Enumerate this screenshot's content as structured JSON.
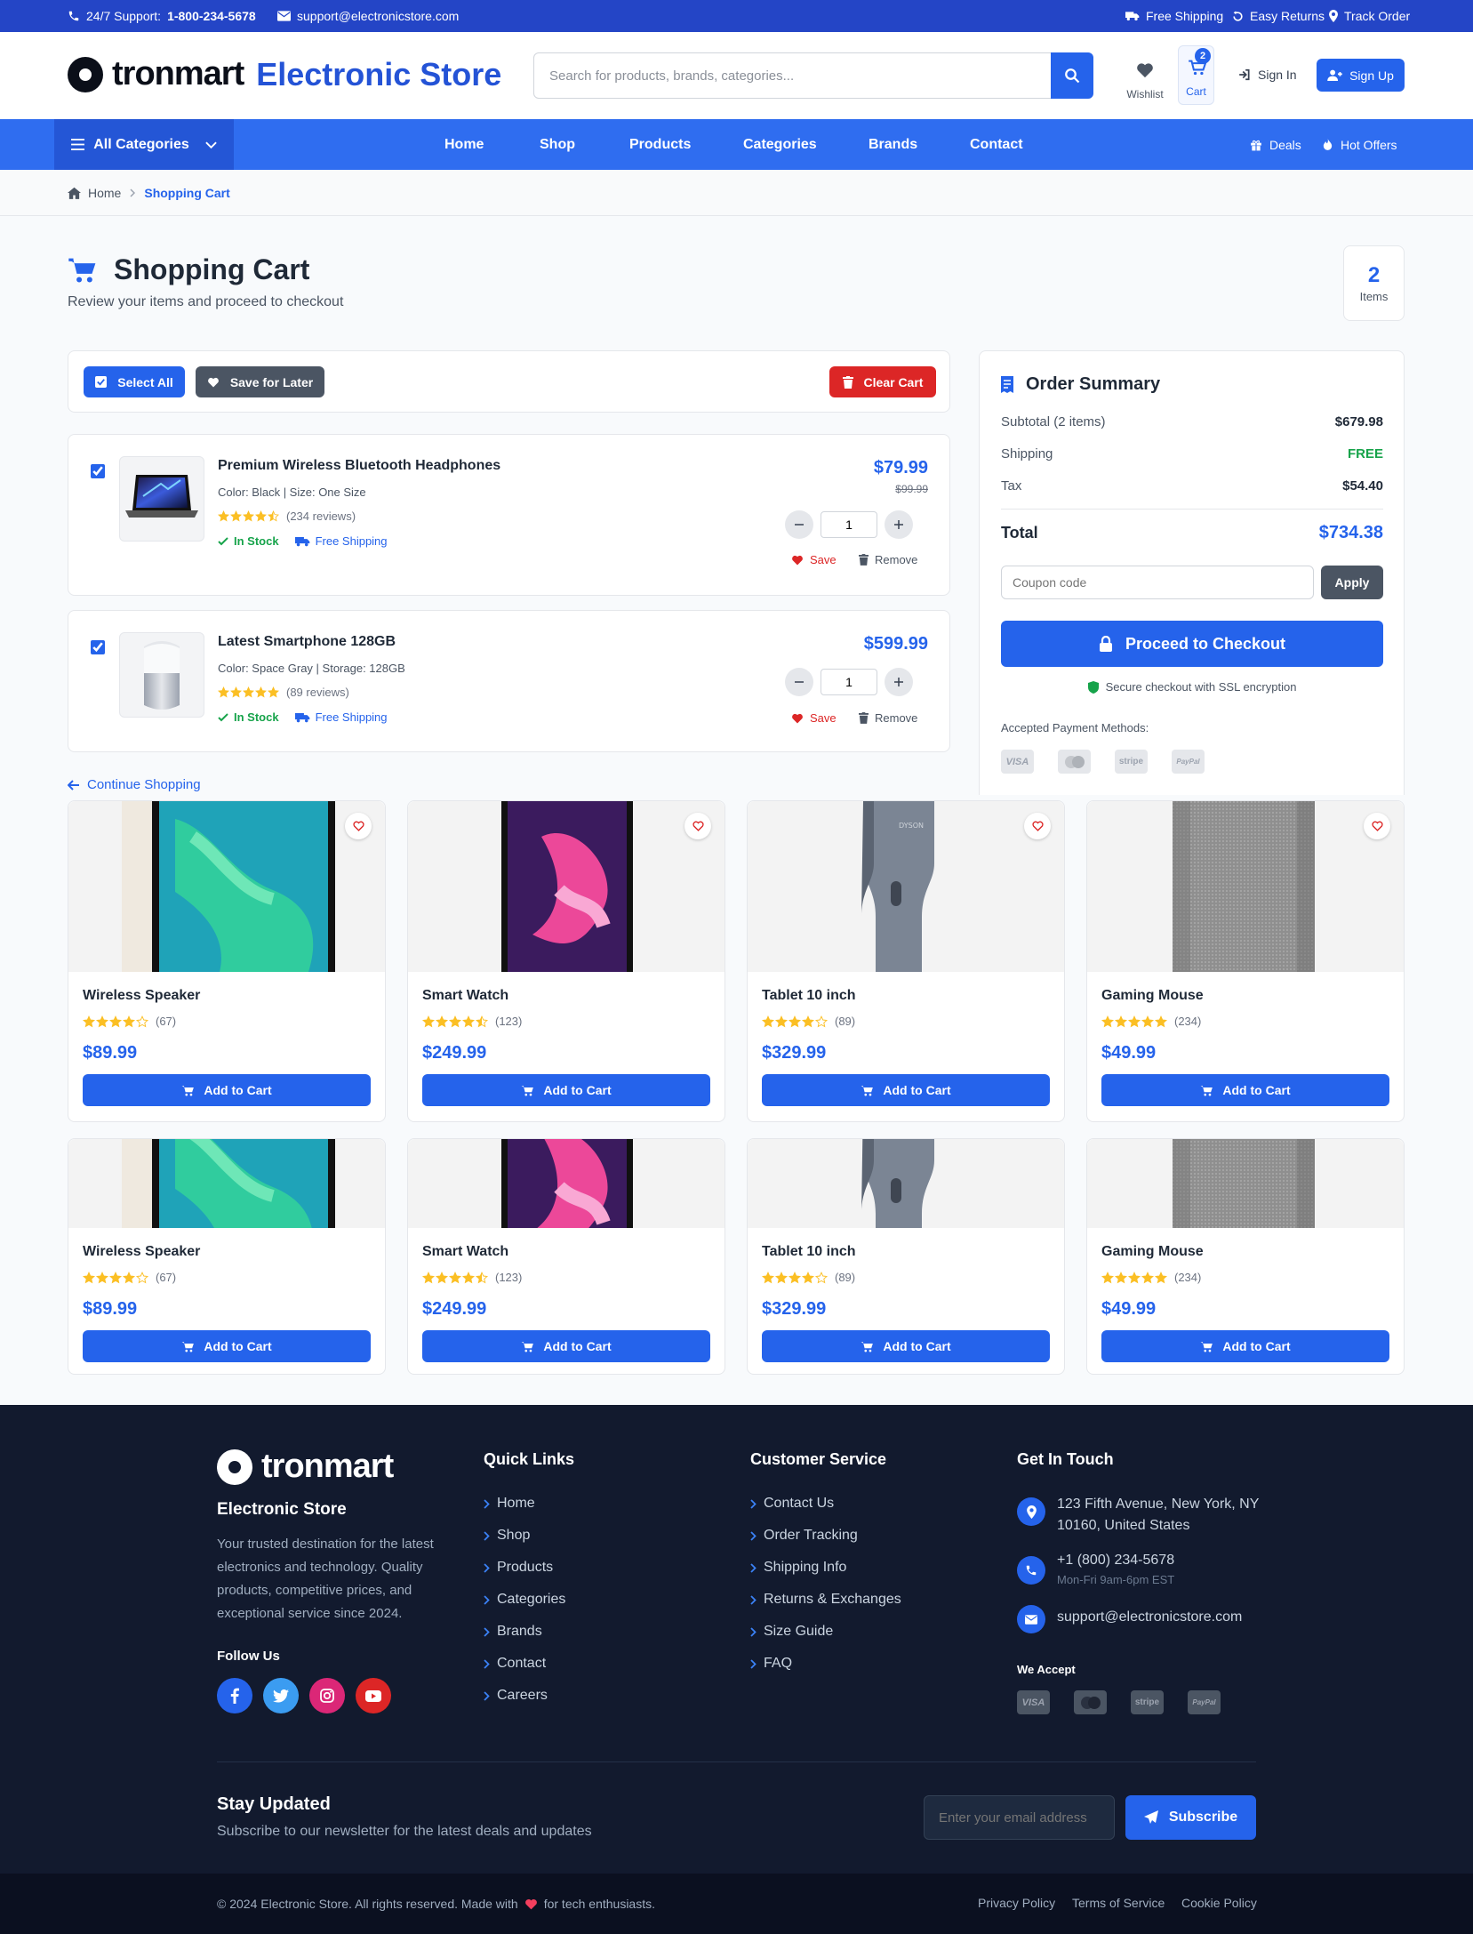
{
  "topbar": {
    "support_prefix": "24/7 Support:",
    "support_phone": "1-800-234-5678",
    "email": "support@electronicstore.com",
    "free_shipping": "Free Shipping",
    "easy_returns": "Easy Returns",
    "track_order": "Track Order"
  },
  "header": {
    "logo_text": "tronmart",
    "store_name": "Electronic Store",
    "search_placeholder": "Search for products, brands, categories...",
    "wishlist_label": "Wishlist",
    "cart_label": "Cart",
    "cart_count": "2",
    "sign_in": "Sign In",
    "sign_up": "Sign Up"
  },
  "nav": {
    "all_categories": "All Categories",
    "links": [
      "Home",
      "Shop",
      "Products",
      "Categories",
      "Brands",
      "Contact"
    ],
    "deals": "Deals",
    "hot_offers": "Hot Offers"
  },
  "breadcrumb": {
    "home": "Home",
    "current": "Shopping Cart"
  },
  "page": {
    "title": "Shopping Cart",
    "subtitle": "Review your items and proceed to checkout",
    "items_count": "2",
    "items_label": "Items"
  },
  "cart_actions": {
    "select_all": "Select All",
    "save_for_later": "Save for Later",
    "clear_cart": "Clear Cart"
  },
  "cart_items": [
    {
      "name": "Premium Wireless Bluetooth Headphones",
      "variant": "Color: Black | Size: One Size",
      "reviews": "(234 reviews)",
      "rating": 4.5,
      "stock": "In Stock",
      "shipping": "Free Shipping",
      "price": "$79.99",
      "old_price": "$99.99",
      "qty": "1",
      "save": "Save",
      "remove": "Remove"
    },
    {
      "name": "Latest Smartphone 128GB",
      "variant": "Color: Space Gray | Storage: 128GB",
      "reviews": "(89 reviews)",
      "rating": 5,
      "stock": "In Stock",
      "shipping": "Free Shipping",
      "price": "$599.99",
      "old_price": "",
      "qty": "1",
      "save": "Save",
      "remove": "Remove"
    }
  ],
  "continue_shopping": "Continue Shopping",
  "summary": {
    "title": "Order Summary",
    "subtotal_label": "Subtotal (2 items)",
    "subtotal": "$679.98",
    "shipping_label": "Shipping",
    "shipping": "FREE",
    "tax_label": "Tax",
    "tax": "$54.40",
    "total_label": "Total",
    "total": "$734.38",
    "coupon_placeholder": "Coupon code",
    "apply": "Apply",
    "checkout": "Proceed to Checkout",
    "secure": "Secure checkout with SSL encryption",
    "payment_label": "Accepted Payment Methods:",
    "payment_methods": [
      "VISA",
      "mastercard",
      "stripe",
      "PayPal"
    ]
  },
  "products": [
    {
      "name": "Wireless Speaker",
      "rating": 4,
      "reviews": "(67)",
      "price": "$89.99",
      "button": "Add to Cart"
    },
    {
      "name": "Smart Watch",
      "rating": 4.5,
      "reviews": "(123)",
      "price": "$249.99",
      "button": "Add to Cart"
    },
    {
      "name": "Tablet 10 inch",
      "rating": 4,
      "reviews": "(89)",
      "price": "$329.99",
      "button": "Add to Cart"
    },
    {
      "name": "Gaming Mouse",
      "rating": 5,
      "reviews": "(234)",
      "price": "$49.99",
      "button": "Add to Cart"
    },
    {
      "name": "Wireless Speaker",
      "rating": 4,
      "reviews": "(67)",
      "price": "$89.99",
      "button": "Add to Cart"
    },
    {
      "name": "Smart Watch",
      "rating": 4.5,
      "reviews": "(123)",
      "price": "$249.99",
      "button": "Add to Cart"
    },
    {
      "name": "Tablet 10 inch",
      "rating": 4,
      "reviews": "(89)",
      "price": "$329.99",
      "button": "Add to Cart"
    },
    {
      "name": "Gaming Mouse",
      "rating": 5,
      "reviews": "(234)",
      "price": "$49.99",
      "button": "Add to Cart"
    }
  ],
  "footer": {
    "logo_text": "tronmart",
    "store_name": "Electronic Store",
    "about": "Your trusted destination for the latest electronics and technology. Quality products, competitive prices, and exceptional service since 2024.",
    "follow_us": "Follow Us",
    "quick_links_title": "Quick Links",
    "quick_links": [
      "Home",
      "Shop",
      "Products",
      "Categories",
      "Brands",
      "Contact",
      "Careers"
    ],
    "customer_service_title": "Customer Service",
    "customer_service": [
      "Contact Us",
      "Order Tracking",
      "Shipping Info",
      "Returns & Exchanges",
      "Size Guide",
      "FAQ"
    ],
    "get_in_touch_title": "Get In Touch",
    "address": "123 Fifth Avenue, New York, NY 10160, United States",
    "phone": "+1 (800) 234-5678",
    "hours": "Mon-Fri 9am-6pm EST",
    "email": "support@electronicstore.com",
    "we_accept": "We Accept",
    "payment_methods": [
      "VISA",
      "mastercard",
      "stripe",
      "PayPal"
    ],
    "newsletter_title": "Stay Updated",
    "newsletter_text": "Subscribe to our newsletter for the latest deals and updates",
    "newsletter_placeholder": "Enter your email address",
    "subscribe": "Subscribe",
    "copyright_pre": "© 2024 Electronic Store. All rights reserved. Made with",
    "copyright_post": "for tech enthusiasts.",
    "legal": [
      "Privacy Policy",
      "Terms of Service",
      "Cookie Policy"
    ]
  },
  "colors": {
    "primary": "#2563eb",
    "nav": "#2f6df0",
    "topbar": "#2445c6",
    "danger": "#dc2626",
    "success": "#16a34a",
    "footer": "#121a2e",
    "star": "#fbbf24"
  }
}
